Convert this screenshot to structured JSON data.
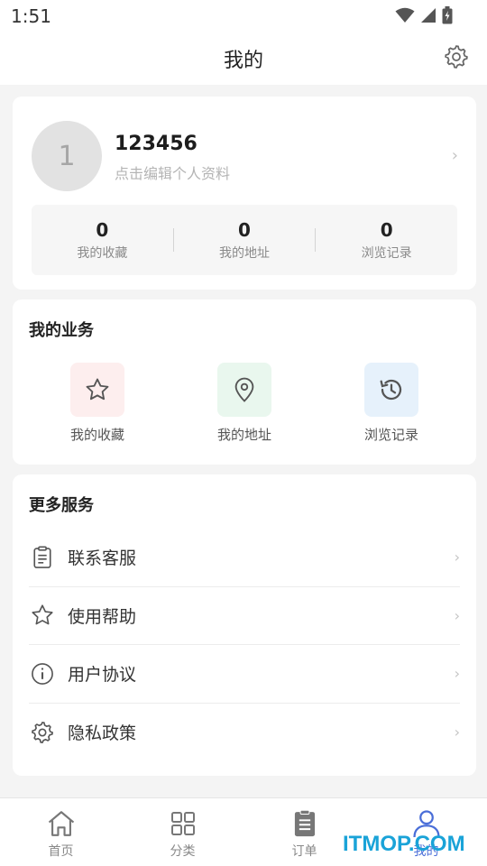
{
  "status": {
    "time": "1:51"
  },
  "header": {
    "title": "我的"
  },
  "profile": {
    "avatar_initial": "1",
    "username": "123456",
    "hint": "点击编辑个人资料",
    "chevron": "›",
    "stats": [
      {
        "value": "0",
        "label": "我的收藏"
      },
      {
        "value": "0",
        "label": "我的地址"
      },
      {
        "value": "0",
        "label": "浏览记录"
      }
    ]
  },
  "business": {
    "title": "我的业务",
    "items": [
      {
        "label": "我的收藏",
        "icon": "star-icon",
        "bg": "#fdeeee"
      },
      {
        "label": "我的地址",
        "icon": "location-pin-icon",
        "bg": "#e9f7ee"
      },
      {
        "label": "浏览记录",
        "icon": "history-icon",
        "bg": "#e6f1fb"
      }
    ]
  },
  "services": {
    "title": "更多服务",
    "items": [
      {
        "label": "联系客服",
        "icon": "clipboard-icon"
      },
      {
        "label": "使用帮助",
        "icon": "star-outline-icon"
      },
      {
        "label": "用户协议",
        "icon": "info-icon"
      },
      {
        "label": "隐私政策",
        "icon": "gear-icon"
      }
    ],
    "chevron": "›"
  },
  "tabs": [
    {
      "label": "首页",
      "icon": "home-icon",
      "active": false
    },
    {
      "label": "分类",
      "icon": "grid-icon",
      "active": false
    },
    {
      "label": "订单",
      "icon": "order-list-icon",
      "active": false
    },
    {
      "label": "我的",
      "icon": "user-icon",
      "active": true
    }
  ],
  "watermark": "ITMOP.COM",
  "colors": {
    "accent": "#4a6ed8",
    "watermark": "#1aa3d8",
    "background": "#f4f4f4"
  }
}
